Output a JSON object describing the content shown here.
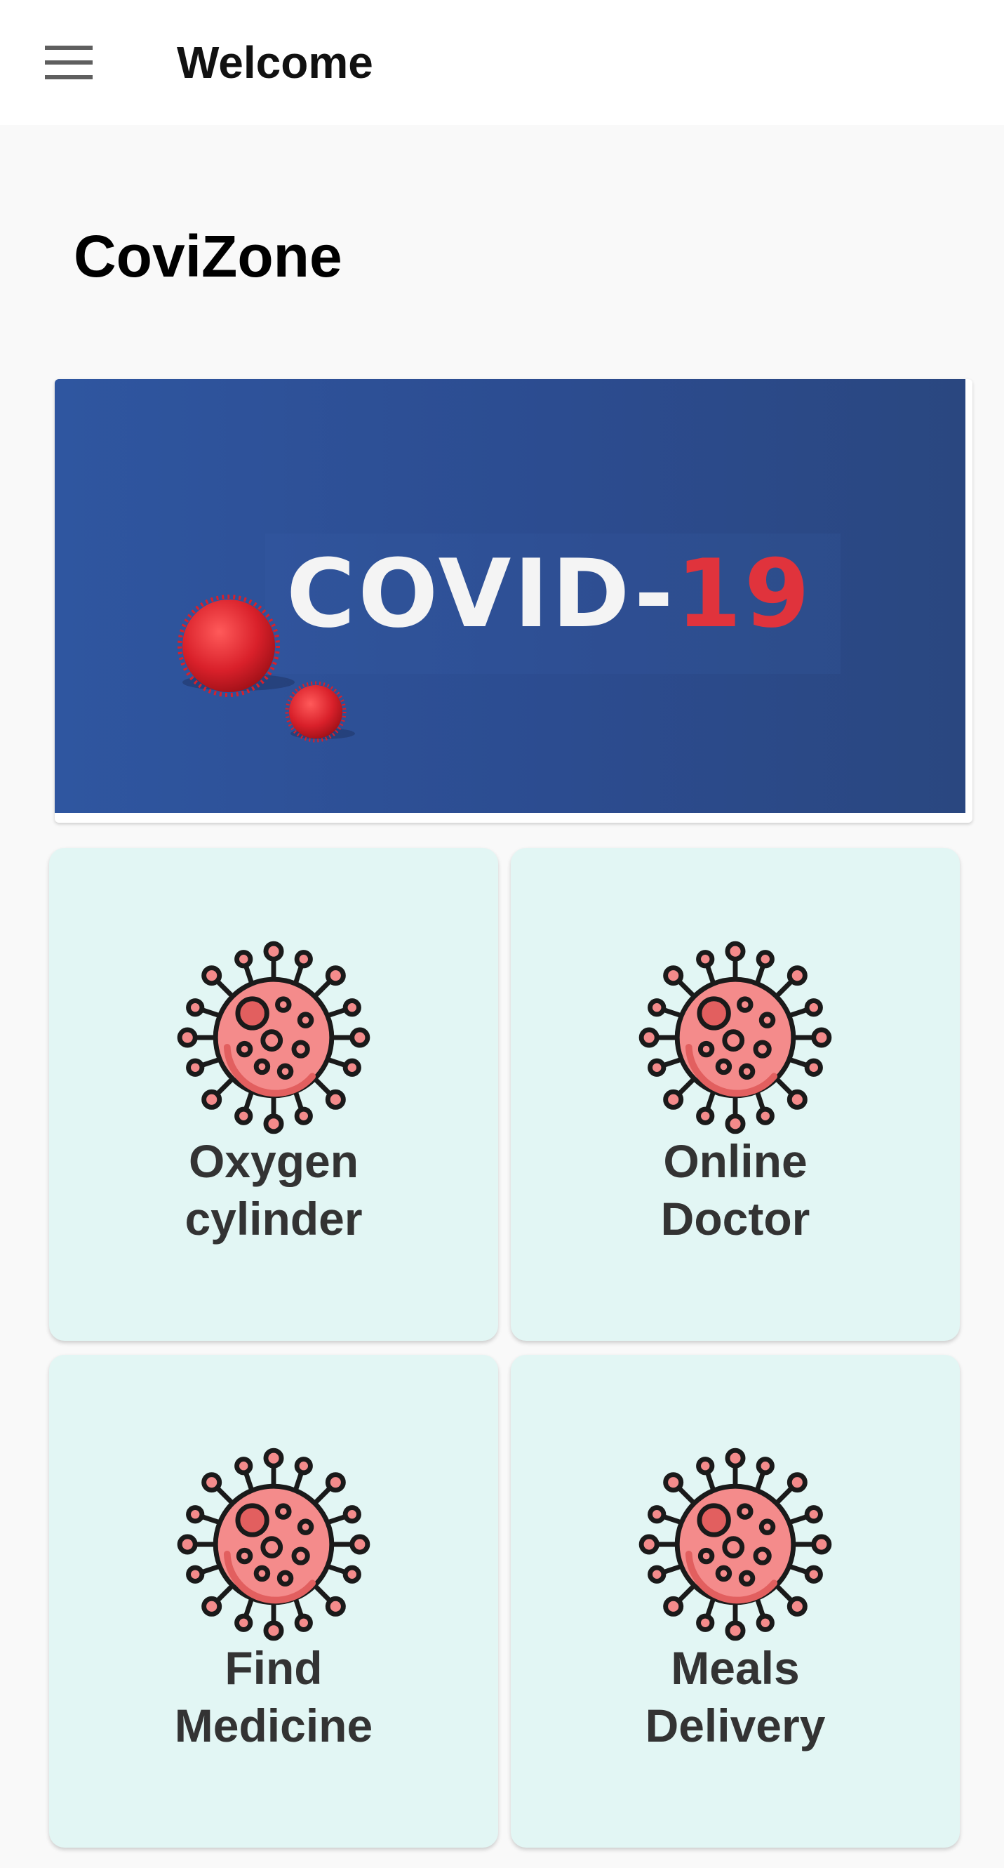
{
  "appbar": {
    "title": "Welcome",
    "menu_icon": "hamburger-menu-icon"
  },
  "page": {
    "title": "CoviZone"
  },
  "banner": {
    "text_main": "COVID-",
    "text_accent": "19",
    "colors": {
      "background": "#2f4f91",
      "text_main": "#f4f4f4",
      "text_accent": "#e0333c",
      "virus": "#d9202a"
    }
  },
  "tiles": [
    {
      "line1": "Oxygen",
      "line2": "cylinder",
      "icon": "virus-icon"
    },
    {
      "line1": "Online",
      "line2": "Doctor",
      "icon": "virus-icon"
    },
    {
      "line1": "Find",
      "line2": "Medicine",
      "icon": "virus-icon"
    },
    {
      "line1": "Meals",
      "line2": "Delivery",
      "icon": "virus-icon"
    }
  ],
  "colors": {
    "tile_background": "#e2f6f4",
    "virus_fill": "#f48b8b",
    "virus_outline": "#1a1a1a"
  }
}
